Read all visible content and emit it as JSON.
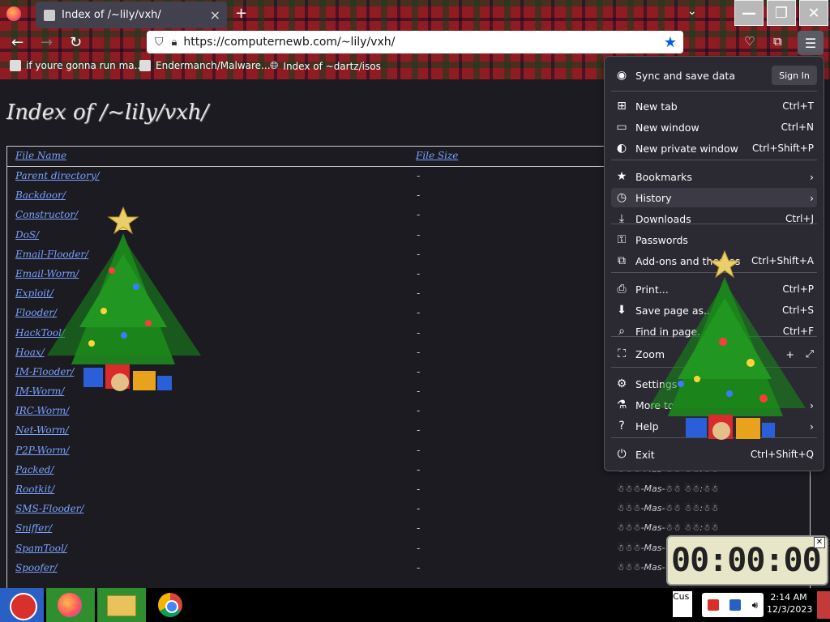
{
  "tab": {
    "title": "Index of /~lily/vxh/",
    "close": "×"
  },
  "new_tab_icon": "plus-icon",
  "url": "https://computernewb.com/~lily/vxh/",
  "bookmarks": [
    {
      "label": "if youre gonna run ma..."
    },
    {
      "label": "Endermanch/Malware..."
    },
    {
      "label": "Index of ~dartz/isos"
    }
  ],
  "page": {
    "heading": "Index of /~lily/vxh/",
    "col_name": "File Name",
    "col_size": "File Size",
    "rows": [
      {
        "name": "Parent directory/",
        "size": "-"
      },
      {
        "name": "Backdoor/",
        "size": "-"
      },
      {
        "name": "Constructor/",
        "size": "-"
      },
      {
        "name": "DoS/",
        "size": "-"
      },
      {
        "name": "Email-Flooder/",
        "size": "-"
      },
      {
        "name": "Email-Worm/",
        "size": "-"
      },
      {
        "name": "Exploit/",
        "size": "-"
      },
      {
        "name": "Flooder/",
        "size": "-"
      },
      {
        "name": "HackTool/",
        "size": "-"
      },
      {
        "name": "Hoax/",
        "size": "-"
      },
      {
        "name": "IM-Flooder/",
        "size": "-"
      },
      {
        "name": "IM-Worm/",
        "size": "-"
      },
      {
        "name": "IRC-Worm/",
        "size": "-"
      },
      {
        "name": "Net-Worm/",
        "size": "-"
      },
      {
        "name": "P2P-Worm/",
        "size": "-"
      },
      {
        "name": "Packed/",
        "size": "-"
      },
      {
        "name": "Rootkit/",
        "size": "-"
      },
      {
        "name": "SMS-Flooder/",
        "size": "-"
      },
      {
        "name": "Sniffer/",
        "size": "-"
      },
      {
        "name": "SpamTool/",
        "size": "-"
      },
      {
        "name": "Spoofer/",
        "size": "-"
      }
    ],
    "date_text": "☃☃☃-Mas-☃☃ ☃☃:☃☃"
  },
  "menu": {
    "sync_label": "Sync and save data",
    "sign_in": "Sign In",
    "items": [
      {
        "label": "New tab",
        "shortcut": "Ctrl+T",
        "icon": "new-tab-icon"
      },
      {
        "label": "New window",
        "shortcut": "Ctrl+N",
        "icon": "window-icon"
      },
      {
        "label": "New private window",
        "shortcut": "Ctrl+Shift+P",
        "icon": "mask-icon"
      },
      {
        "label": "Bookmarks",
        "shortcut": "",
        "icon": "star-icon"
      },
      {
        "label": "History",
        "shortcut": "",
        "icon": "clock-icon"
      },
      {
        "label": "Downloads",
        "shortcut": "Ctrl+J",
        "icon": "download-icon"
      },
      {
        "label": "Passwords",
        "shortcut": "",
        "icon": "key-icon"
      },
      {
        "label": "Add-ons and themes",
        "shortcut": "Ctrl+Shift+A",
        "icon": "puzzle-icon"
      },
      {
        "label": "Print...",
        "shortcut": "Ctrl+P",
        "icon": "print-icon"
      },
      {
        "label": "Save page as...",
        "shortcut": "Ctrl+S",
        "icon": "save-icon"
      },
      {
        "label": "Find in page...",
        "shortcut": "Ctrl+F",
        "icon": "search-icon"
      },
      {
        "label": "Zoom",
        "shortcut": "",
        "icon": "zoom-icon"
      },
      {
        "label": "Settings",
        "shortcut": "",
        "icon": "gear-icon"
      },
      {
        "label": "More tools",
        "shortcut": "",
        "icon": "tools-icon"
      },
      {
        "label": "Help",
        "shortcut": "",
        "icon": "help-icon"
      },
      {
        "label": "Exit",
        "shortcut": "Ctrl+Shift+Q",
        "icon": "power-icon"
      }
    ]
  },
  "widget": {
    "digits": "00:00:00"
  },
  "taskbar": {
    "cus": "Cus",
    "time": "2:14 AM",
    "date": "12/3/2023"
  }
}
